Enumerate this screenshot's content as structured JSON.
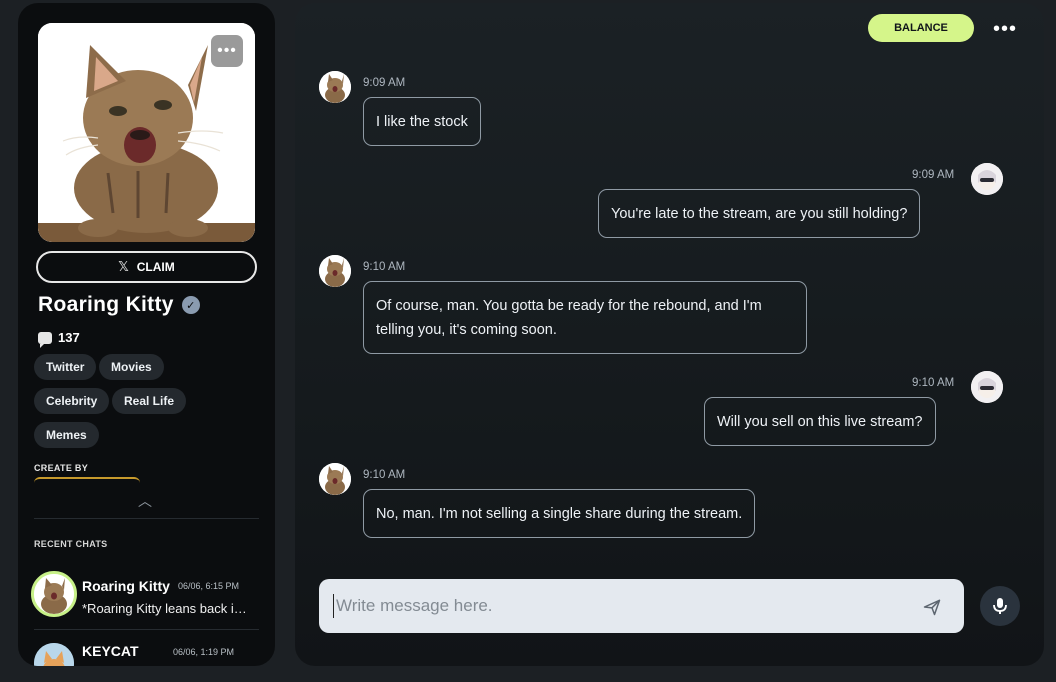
{
  "character": {
    "more_label": "•••",
    "claim_label": "CLAIM",
    "x_glyph": "𝕏",
    "name": "Roaring Kitty",
    "verified_glyph": "✓",
    "message_count": "137",
    "tags": [
      "Twitter",
      "Movies",
      "Celebrity",
      "Real Life",
      "Memes"
    ],
    "create_by_label": "CREATE BY",
    "collapse_glyph": "︿"
  },
  "recent": {
    "label": "RECENT CHATS",
    "items": [
      {
        "name": "Roaring Kitty",
        "time": "06/06, 6:15 PM",
        "preview": "*Roaring Kitty leans back in his chair*"
      },
      {
        "name": "KEYCAT",
        "time": "06/06, 1:19 PM",
        "preview": ""
      }
    ]
  },
  "header": {
    "balance_label": "BALANCE",
    "menu_label": "•••"
  },
  "messages": [
    {
      "sender": "bot",
      "time": "9:09 AM",
      "text": "I like the stock"
    },
    {
      "sender": "user",
      "time": "9:09 AM",
      "text": "You're late to the stream, are you still holding?"
    },
    {
      "sender": "bot",
      "time": "9:10 AM",
      "text": "Of course, man. You gotta be ready for the rebound, and I'm telling you, it's coming soon."
    },
    {
      "sender": "user",
      "time": "9:10 AM",
      "text": "Will you sell on this live stream?"
    },
    {
      "sender": "bot",
      "time": "9:10 AM",
      "text": "No, man. I'm not selling a single share during the stream."
    }
  ],
  "composer": {
    "placeholder": "Write message here."
  },
  "colors": {
    "accent": "#d5f58a",
    "sidebar_bg": "#0b0d0f",
    "bubble_border": "#8f9aa4",
    "composer_bg": "#e4e9ef"
  },
  "icons": {
    "more": "more-icon",
    "claim": "x-logo-icon",
    "verified": "verified-badge-icon",
    "messages": "chat-bubble-icon",
    "collapse": "chevron-up-icon",
    "send": "send-icon",
    "mic": "microphone-icon"
  }
}
